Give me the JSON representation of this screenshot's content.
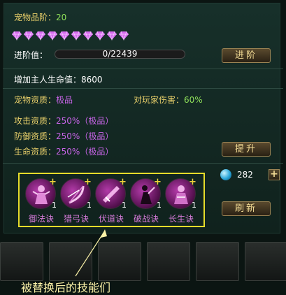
{
  "pet": {
    "grade_label": "宠物品阶：",
    "grade_value": "20",
    "gem_count": 10,
    "advance_label": "进阶值：",
    "advance_value": "0/22439",
    "advance_progress": 0,
    "advance_button": "进阶",
    "hp_bonus_label": "增加主人生命值：",
    "hp_bonus_value": "8600",
    "quality_label": "宠物资质：",
    "quality_value": "极品",
    "pvp_label": "对玩家伤害：",
    "pvp_value": "60%",
    "attack_label": "攻击资质：",
    "attack_value": "250%（极品）",
    "defense_label": "防御资质：",
    "defense_value": "250%（极品）",
    "life_label": "生命资质：",
    "life_value": "250%（极品）",
    "upgrade_button": "提升"
  },
  "skills": [
    {
      "name": "御法诀",
      "count": "1",
      "plus": "+",
      "icon": "mage-figure-icon"
    },
    {
      "name": "猎弓诀",
      "count": "1",
      "plus": "+",
      "icon": "bow-icon"
    },
    {
      "name": "伏道诀",
      "count": "1",
      "plus": "+",
      "icon": "blade-icon"
    },
    {
      "name": "破战诀",
      "count": "1",
      "plus": "+",
      "icon": "warrior-icon"
    },
    {
      "name": "长生诀",
      "count": "1",
      "plus": "+",
      "icon": "sage-figure-icon"
    }
  ],
  "currency": {
    "value": "282",
    "plus_label": "+",
    "icon": "blue-orb-icon"
  },
  "refresh_button": "刷新",
  "caption": "被替换后的技能们",
  "colors": {
    "highlight_box": "#e6dc2a",
    "gem": "#d86cf0",
    "caption": "#fbf2a8"
  }
}
